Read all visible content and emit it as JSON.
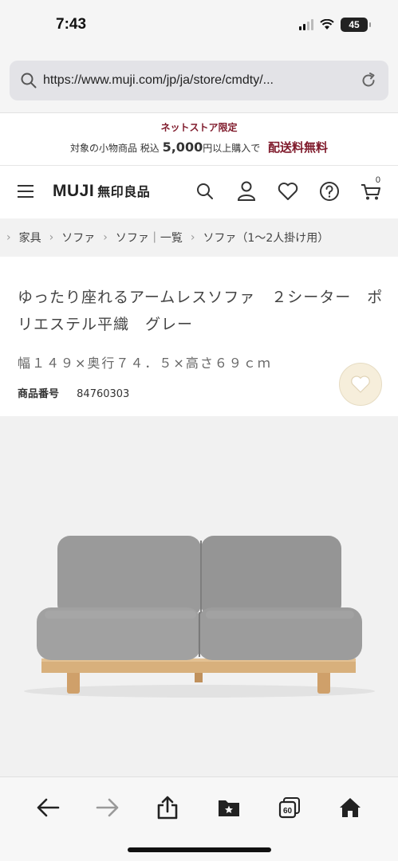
{
  "status": {
    "time": "7:43",
    "battery": "45"
  },
  "browser": {
    "url": "https://www.muji.com/jp/ja/store/cmdty/..."
  },
  "promo": {
    "line1": "ネットストア限定",
    "prefix": "対象の小物商品 税込",
    "amount": "5,000",
    "suffix": "円以上購入で",
    "free": "配送料無料"
  },
  "header": {
    "logo": "MUJI",
    "logo_jp": "無印良品",
    "cart_count": "0"
  },
  "breadcrumb": [
    "家具",
    "ソファ",
    "ソファ｜一覧",
    "ソファ（1〜2人掛け用）"
  ],
  "product": {
    "title": "ゆったり座れるアームレスソファ　２シーター　ポリエステル平織　グレー",
    "size": "幅１４９×奥行７４．５×高さ６９ｃｍ",
    "code_label": "商品番号",
    "code": "84760303"
  },
  "colors": {
    "accent": "#7f1a2b",
    "fav_bg": "#f6eedb",
    "sofa_fabric": "#9a9a9a",
    "sofa_wood": "#d8b07c"
  },
  "toolbar": {
    "tabs_count": "60"
  }
}
